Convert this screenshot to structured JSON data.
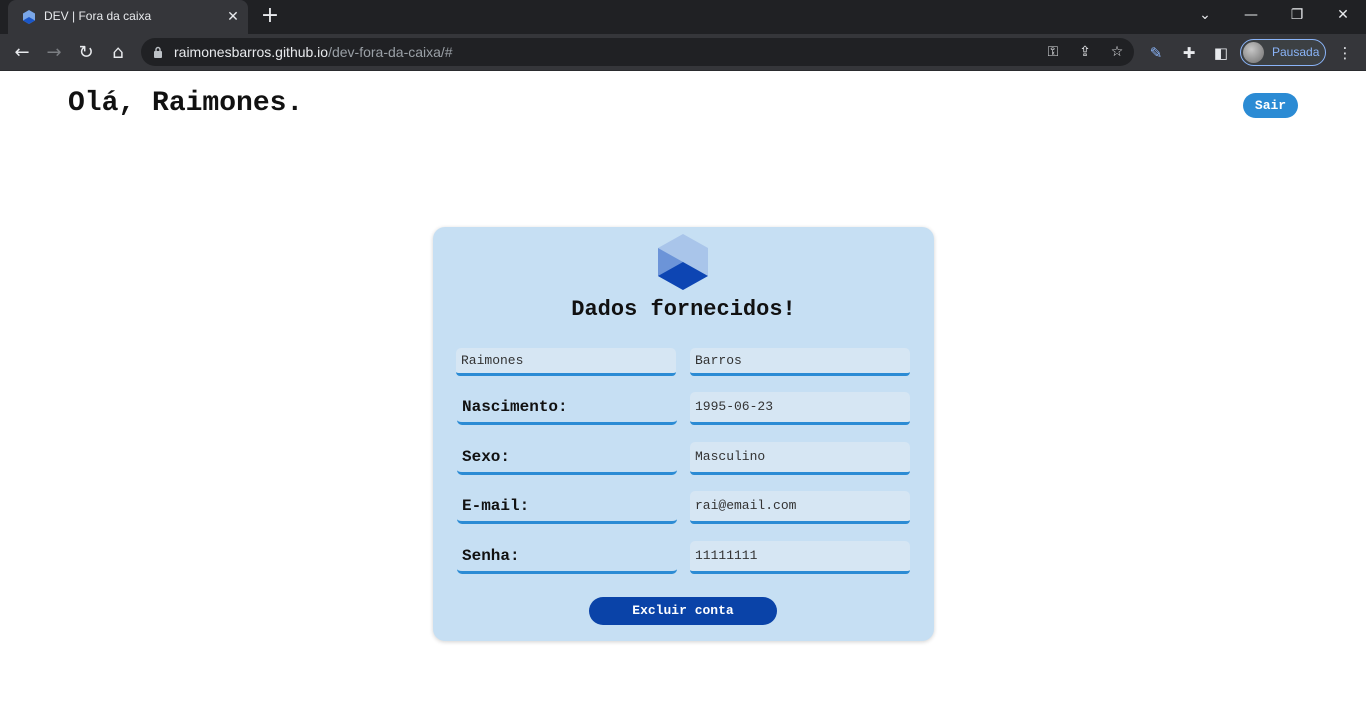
{
  "browser": {
    "tab_title": "DEV | Fora da caixa",
    "url_host": "raimonesbarros.github.io",
    "url_path": "/dev-fora-da-caixa/#",
    "profile_label": "Pausada"
  },
  "header": {
    "greeting": "Olá, Raimones.",
    "logout_label": "Sair"
  },
  "card": {
    "title": "Dados fornecidos!",
    "first_name": "Raimones",
    "last_name": "Barros",
    "rows": [
      {
        "label": "Nascimento:",
        "value": "1995-06-23"
      },
      {
        "label": "Sexo:",
        "value": "Masculino"
      },
      {
        "label": "E-mail:",
        "value": "rai@email.com"
      },
      {
        "label": "Senha:",
        "value": "11111111"
      }
    ],
    "delete_label": "Excluir conta"
  },
  "colors": {
    "accent": "#2b8bd4",
    "card_bg": "#c6dff3",
    "delete_button": "#0a43a8"
  }
}
